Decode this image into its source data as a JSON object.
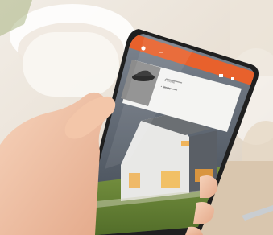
{
  "photo": {
    "app_bar_title": "",
    "card_line_1": "• 1 Mode",
    "card_line_2": "• Mode",
    "colors": {
      "app_orange": "#e8612c",
      "card_bg": "#f4f4f2",
      "tile_bg": "#8c8c8c",
      "phone_body": "#2a2a2a",
      "skin": "#f1c3a6",
      "lawn": "#6f8a3b",
      "sky_dusk": "#4d5560",
      "window_glow": "#f0b45a"
    },
    "icons": [
      "app-logo-icon",
      "menu-icon",
      "settings-icon",
      "phone-icon",
      "car-thumbnail-icon"
    ]
  }
}
